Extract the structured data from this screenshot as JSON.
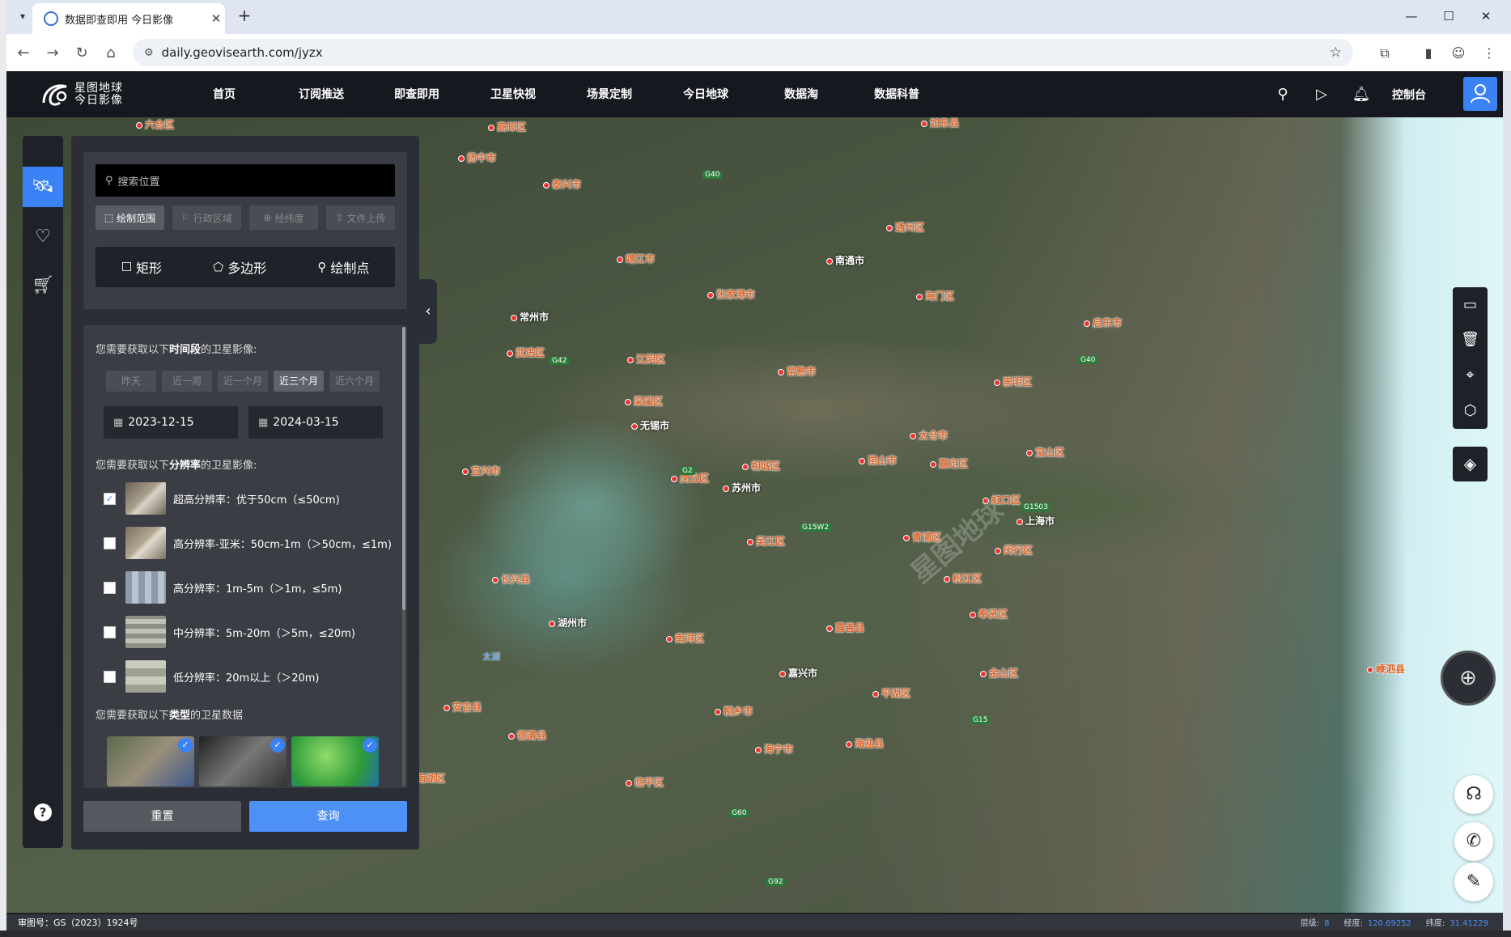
{
  "browser": {
    "tab_title": "数据即查即用 今日影像",
    "url": "daily.geovisearth.com/jyzx",
    "new_tab_icon": "plus-icon",
    "window_controls": [
      "minimize-icon",
      "maximize-icon",
      "close-icon"
    ]
  },
  "site": {
    "logo_line1": "星图地球",
    "logo_line2": "今日影像",
    "nav": [
      "首页",
      "订阅推送",
      "即查即用",
      "卫星快视",
      "场景定制",
      "今日地球",
      "数据淘",
      "数据科普"
    ],
    "console": "控制台",
    "header_icons": [
      "location-pin-icon",
      "play-circle-icon",
      "bell-icon",
      "user-icon"
    ]
  },
  "rail": {
    "items": [
      "satellite-icon",
      "heart-icon",
      "cart-icon"
    ],
    "help": "?"
  },
  "panel": {
    "search_placeholder": "搜索位置",
    "modes": [
      "绘制范围",
      "行政区域",
      "经纬度",
      "文件上传"
    ],
    "shapes": [
      "矩形",
      "多边形",
      "绘制点"
    ],
    "time_label_pre": "您需要获取以下",
    "time_label_key": "时间段",
    "time_label_post": "的卫星影像:",
    "time_ranges": [
      "昨天",
      "近一周",
      "近一个月",
      "近三个月",
      "近六个月"
    ],
    "active_range": "近三个月",
    "start_date": "2023-12-15",
    "end_date": "2024-03-15",
    "res_label_pre": "您需要获取以下",
    "res_label_key": "分辨率",
    "res_label_post": "的卫星影像:",
    "resolutions": [
      {
        "label": "超高分辨率：优于50cm（≤50cm)",
        "checked": true
      },
      {
        "label": "高分辨率-亚米：50cm-1m（＞50cm，≤1m)",
        "checked": false
      },
      {
        "label": "高分辨率：1m-5m（＞1m，≤5m)",
        "checked": false
      },
      {
        "label": "中分辨率：5m-20m（＞5m，≤20m)",
        "checked": false
      },
      {
        "label": "低分辨率：20m以上（＞20m)",
        "checked": false
      }
    ],
    "type_label_pre": "您需要获取以下",
    "type_label_key": "类型",
    "type_label_post": "的卫星数据",
    "reset": "重置",
    "query": "查询"
  },
  "map": {
    "cities": [
      "六合区",
      "高邮区",
      "扬中市",
      "泰兴市",
      "如东县",
      "通州区",
      "南通市",
      "靖江市",
      "张家港市",
      "海门区",
      "启东市",
      "常州市",
      "武进区",
      "江阴区",
      "常熟市",
      "崇明区",
      "梁溪区",
      "无锡市",
      "太仓市",
      "宝山区",
      "宜兴市",
      "相城区",
      "虎丘区",
      "苏州市",
      "昆山市",
      "嘉定区",
      "虹口区",
      "上海市",
      "吴江区",
      "青浦区",
      "闵行区",
      "长兴县",
      "松江区",
      "湖州市",
      "南浔区",
      "嘉善县",
      "平湖区",
      "嘉兴市",
      "金山区",
      "奉贤区",
      "南湖区",
      "平湖市",
      "桐乡市",
      "海盐县",
      "德清县",
      "海宁市",
      "临平区",
      "嵊泗县",
      "安吉县"
    ],
    "lake": "太湖",
    "roads": [
      "G40",
      "G42",
      "G2",
      "G15W2",
      "G1503",
      "G15",
      "G60",
      "G92",
      "G40"
    ],
    "watermark": "星图地球"
  },
  "status": {
    "approval": "审图号：GS（2023）1924号",
    "level_label": "层级:",
    "level": "8",
    "lng_label": "经度:",
    "lng": "120.69252",
    "lat_label": "纬度:",
    "lat": "31.41229"
  },
  "colors": {
    "accent": "#3b82f6",
    "panel_bg": "#2b2e35",
    "header_bg": "#15181f",
    "city_label": "#d9662c"
  }
}
